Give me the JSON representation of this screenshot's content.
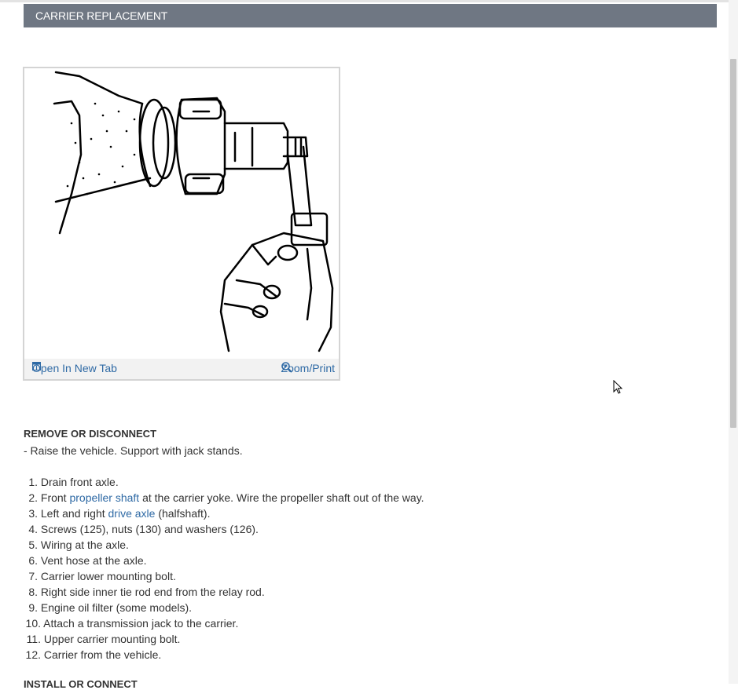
{
  "section": {
    "title": "CARRIER REPLACEMENT"
  },
  "figure": {
    "open_label": "Open In New Tab",
    "zoom_label": "Zoom/Print"
  },
  "remove": {
    "heading": "REMOVE OR DISCONNECT",
    "prep": "-  Raise the vehicle. Support with jack stands.",
    "steps": [
      {
        "num": "1.",
        "pre": "Drain front axle.",
        "link": "",
        "post": ""
      },
      {
        "num": "2.",
        "pre": "Front ",
        "link": "propeller shaft",
        "post": " at the carrier yoke. Wire the propeller shaft out of the way."
      },
      {
        "num": "3.",
        "pre": "Left and right ",
        "link": "drive axle",
        "post": " (halfshaft)."
      },
      {
        "num": "4.",
        "pre": "Screws (125), nuts (130) and washers (126).",
        "link": "",
        "post": ""
      },
      {
        "num": "5.",
        "pre": "Wiring at the axle.",
        "link": "",
        "post": ""
      },
      {
        "num": "6.",
        "pre": "Vent hose at the axle.",
        "link": "",
        "post": ""
      },
      {
        "num": "7.",
        "pre": "Carrier lower mounting bolt.",
        "link": "",
        "post": ""
      },
      {
        "num": "8.",
        "pre": "Right side inner tie rod end from the relay rod.",
        "link": "",
        "post": ""
      },
      {
        "num": "9.",
        "pre": "Engine oil filter (some models).",
        "link": "",
        "post": ""
      },
      {
        "num": "10.",
        "pre": "Attach a transmission jack to the carrier.",
        "link": "",
        "post": ""
      },
      {
        "num": "11.",
        "pre": "Upper carrier mounting bolt.",
        "link": "",
        "post": ""
      },
      {
        "num": "12.",
        "pre": "Carrier from the vehicle.",
        "link": "",
        "post": ""
      }
    ]
  },
  "install": {
    "heading": "INSTALL OR CONNECT"
  },
  "icons": {
    "open": "open-new-tab-icon",
    "zoom": "zoom-icon",
    "cursor": "mouse-pointer-icon"
  },
  "colors": {
    "header_bg": "#6f7783",
    "link": "#2f6aa5",
    "text": "#333333"
  }
}
